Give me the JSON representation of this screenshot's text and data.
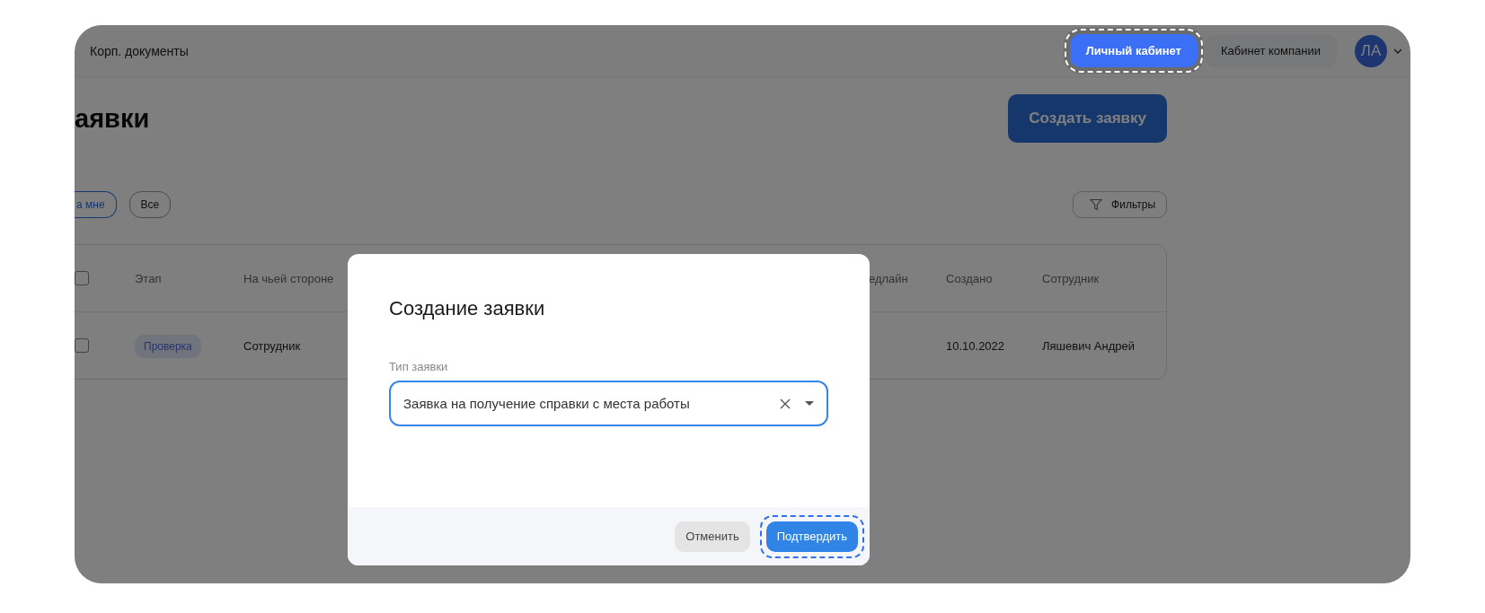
{
  "header": {
    "title": "Корп. документы",
    "nav": [
      {
        "label": "Личный кабинет",
        "selected": true,
        "highlighted": true
      },
      {
        "label": "Кабинет компании",
        "selected": false,
        "highlighted": false
      }
    ],
    "avatar": {
      "initials": "ЛА"
    }
  },
  "page": {
    "title": "аявки",
    "create_button": "Создать заявку"
  },
  "chips": [
    {
      "label": "а мне",
      "selected": true
    },
    {
      "label": "Все",
      "selected": false
    }
  ],
  "filters_button": "Фильтры",
  "table": {
    "all_checked": false,
    "columns": [
      "Этап",
      "На чьей стороне",
      "едлайн",
      "Создано",
      "Сотрудник"
    ],
    "rows": [
      {
        "checked": false,
        "stage": "Проверка",
        "side": "Сотрудник",
        "created": "10.10.2022",
        "employee": "Ляшевич Андрей"
      }
    ]
  },
  "modal": {
    "title": "Создание заявки",
    "field_label": "Тип заявки",
    "field_value": "Заявка на получение справки с места работы",
    "buttons": [
      {
        "label": "Отменить",
        "kind": "secondary",
        "highlighted": false
      },
      {
        "label": "Подтвердить",
        "kind": "primary",
        "highlighted": true
      }
    ]
  }
}
